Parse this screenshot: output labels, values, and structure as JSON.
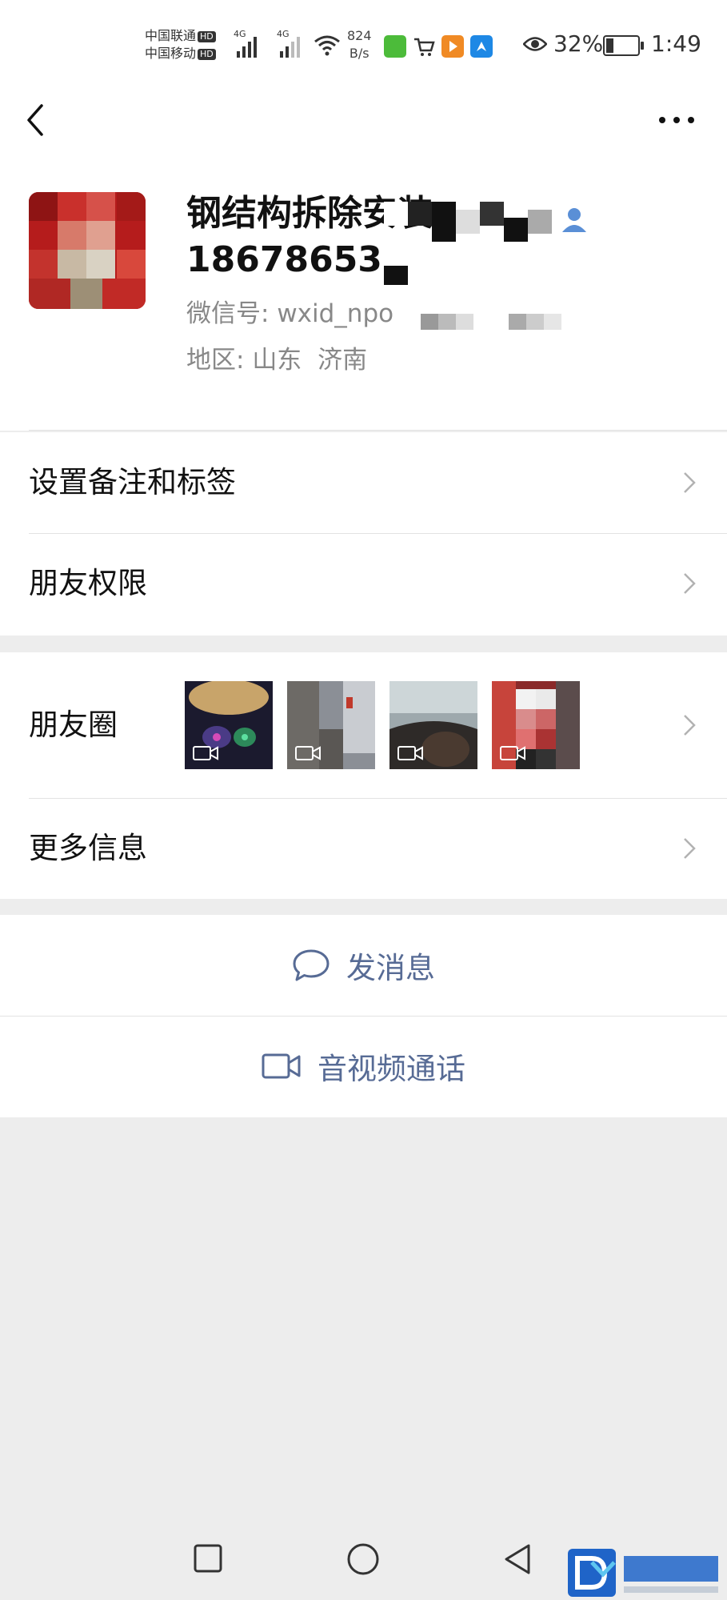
{
  "status_bar": {
    "carrier_1": "中国联通",
    "carrier_2": "中国移动",
    "hd_badge": "HD",
    "network_1": "4G",
    "network_2": "4G",
    "speed_value": "824",
    "speed_unit": "B/s",
    "battery_percent": "32%",
    "battery_level": 0.32,
    "time": "1:49"
  },
  "nav": {
    "back_icon": "chevron-left-icon",
    "more_icon": "more-horizontal-icon"
  },
  "profile": {
    "name": "钢结构拆除安装",
    "phone": "18678653",
    "wechat_id_label": "微信号:",
    "wechat_id_value": "wxid_npo",
    "region_label": "地区:",
    "region_province": "山东",
    "region_city": "济南"
  },
  "menu": {
    "remark_tags": "设置备注和标签",
    "friend_permissions": "朋友权限",
    "moments": "朋友圈",
    "more_info": "更多信息"
  },
  "actions": {
    "send_message": "发消息",
    "video_call": "音视频通话"
  },
  "colors": {
    "link_blue": "#576b95",
    "background": "#ededed",
    "card": "#ffffff",
    "divider": "#e3e3e3"
  }
}
